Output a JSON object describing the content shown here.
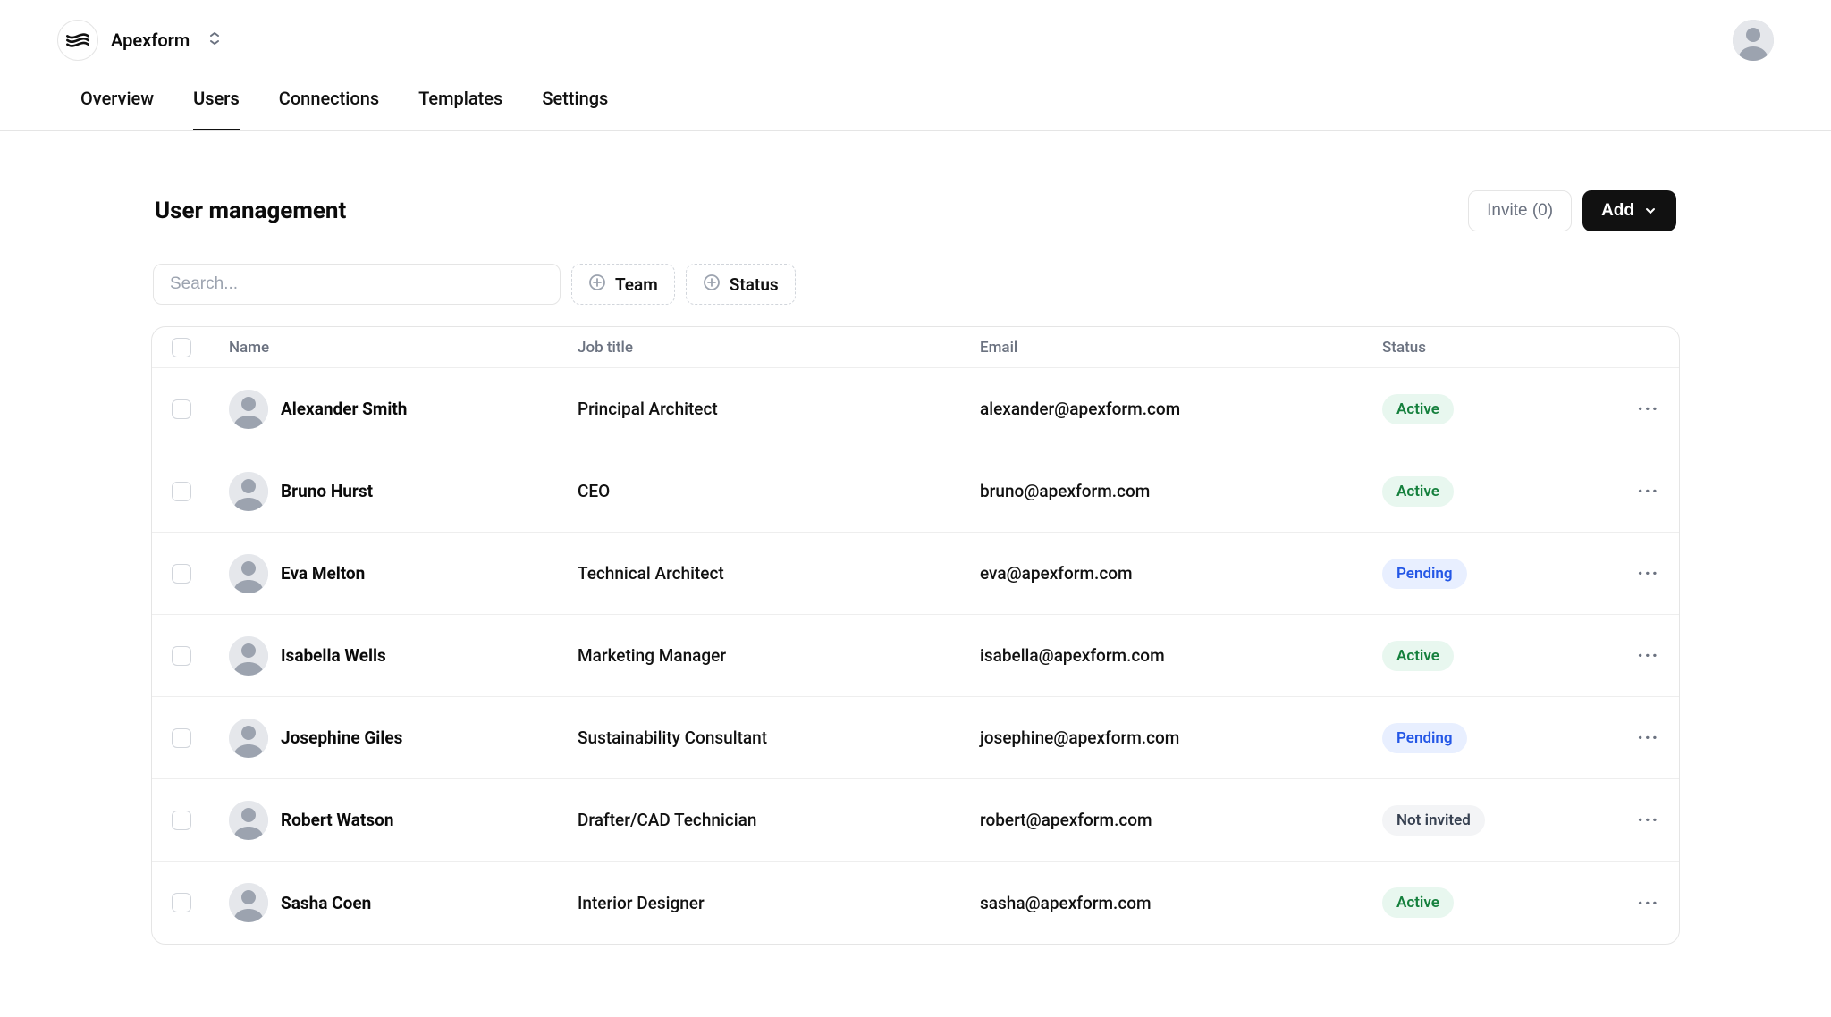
{
  "workspace": {
    "name": "Apexform"
  },
  "nav": {
    "tabs": [
      {
        "label": "Overview",
        "active": false
      },
      {
        "label": "Users",
        "active": true
      },
      {
        "label": "Connections",
        "active": false
      },
      {
        "label": "Templates",
        "active": false
      },
      {
        "label": "Settings",
        "active": false
      }
    ]
  },
  "page": {
    "title": "User management",
    "invite_label": "Invite (0)",
    "add_label": "Add"
  },
  "filters": {
    "search_placeholder": "Search...",
    "chips": [
      {
        "label": "Team"
      },
      {
        "label": "Status"
      }
    ]
  },
  "table": {
    "columns": [
      {
        "label": "Name"
      },
      {
        "label": "Job title"
      },
      {
        "label": "Email"
      },
      {
        "label": "Status"
      }
    ],
    "rows": [
      {
        "name": "Alexander Smith",
        "job": "Principal Architect",
        "email": "alexander@apexform.com",
        "status": "active",
        "status_label": "Active"
      },
      {
        "name": "Bruno Hurst",
        "job": "CEO",
        "email": "bruno@apexform.com",
        "status": "active",
        "status_label": "Active"
      },
      {
        "name": "Eva Melton",
        "job": "Technical Architect",
        "email": "eva@apexform.com",
        "status": "pending",
        "status_label": "Pending"
      },
      {
        "name": "Isabella Wells",
        "job": "Marketing Manager",
        "email": "isabella@apexform.com",
        "status": "active",
        "status_label": "Active"
      },
      {
        "name": "Josephine Giles",
        "job": "Sustainability Consultant",
        "email": "josephine@apexform.com",
        "status": "pending",
        "status_label": "Pending"
      },
      {
        "name": "Robert Watson",
        "job": "Drafter/CAD Technician",
        "email": "robert@apexform.com",
        "status": "not_invited",
        "status_label": "Not invited"
      },
      {
        "name": "Sasha Coen",
        "job": "Interior Designer",
        "email": "sasha@apexform.com",
        "status": "active",
        "status_label": "Active"
      }
    ]
  }
}
